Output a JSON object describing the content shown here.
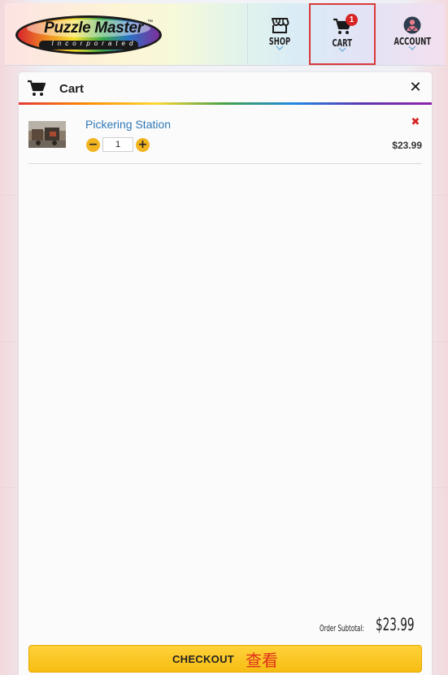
{
  "header": {
    "logo": {
      "name": "Puzzle Master",
      "tm": "™",
      "sub": "Incorporated"
    },
    "nav": {
      "shop_label": "SHOP",
      "cart_label": "CART",
      "cart_badge": "1",
      "account_label": "ACCOUNT"
    }
  },
  "cart": {
    "title": "Cart",
    "close_glyph": "✕",
    "items": [
      {
        "name": "Pickering Station",
        "quantity": "1",
        "price": "$23.99",
        "minus": "−",
        "plus": "+",
        "remove": "✖"
      }
    ],
    "subtotal_label": "Order Subtotal:",
    "subtotal_value": "$23.99",
    "checkout_label": "CHECKOUT",
    "checkout_annotation": "查看"
  },
  "colors": {
    "accent": "#f6bd13",
    "link": "#2f79b6",
    "badge": "#d62424",
    "highlight_border": "#d93a3a"
  }
}
